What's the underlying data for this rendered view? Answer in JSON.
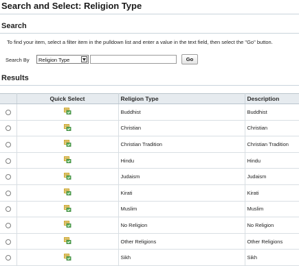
{
  "page": {
    "title": "Search and Select: Religion Type"
  },
  "search": {
    "heading": "Search",
    "instructions": "To find your item, select a filter item in the pulldown list and enter a value in the text field, then select the \"Go\" button.",
    "search_by_label": "Search By",
    "filter_selected": "Religion Type",
    "text_value": "",
    "go_label": "Go"
  },
  "results": {
    "heading": "Results",
    "columns": [
      "",
      "Quick Select",
      "Religion Type",
      "Description"
    ],
    "rows": [
      {
        "religion_type": "Buddhist",
        "description": "Buddhist"
      },
      {
        "religion_type": "Christian",
        "description": "Christian"
      },
      {
        "religion_type": "Christian Tradition",
        "description": "Christian Tradition"
      },
      {
        "religion_type": "Hindu",
        "description": "Hindu"
      },
      {
        "religion_type": "Judaism",
        "description": "Judaism"
      },
      {
        "religion_type": "Kirati",
        "description": "Kirati"
      },
      {
        "religion_type": "Muslim",
        "description": "Muslim"
      },
      {
        "religion_type": "No Religion",
        "description": "No Religion"
      },
      {
        "religion_type": "Other Religions",
        "description": "Other Religions"
      },
      {
        "religion_type": "Sikh",
        "description": "Sikh"
      }
    ],
    "quick_select_icon": "quick-select-icon"
  },
  "colors": {
    "header_bg": "#e6ebef",
    "rule": "#c8d3db",
    "icon_yellow": "#e8c23a",
    "icon_green": "#3f9b3f"
  }
}
